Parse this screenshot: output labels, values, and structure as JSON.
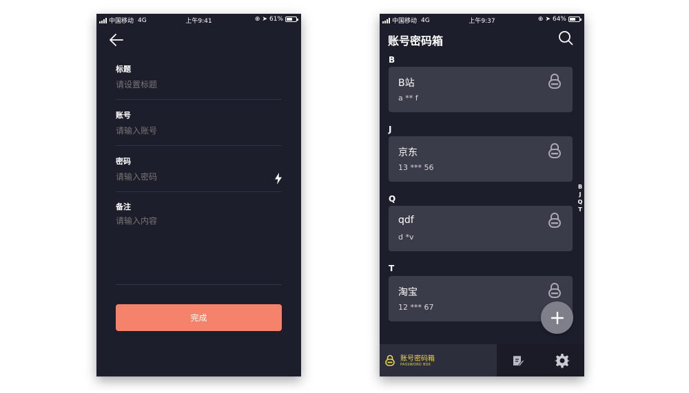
{
  "left_screen": {
    "status_bar": {
      "carrier": "中国移动",
      "network": "4G",
      "time": "上午9:41",
      "battery": "61%",
      "battery_level": 0.61
    },
    "fields": {
      "title_label": "标题",
      "title_placeholder": "请设置标题",
      "account_label": "账号",
      "account_placeholder": "请输入账号",
      "password_label": "密码",
      "password_placeholder": "请输入密码",
      "note_label": "备注",
      "note_placeholder": "请输入内容"
    },
    "done_label": "完成",
    "colors": {
      "background": "#1d1e2c",
      "accent": "#f5836c"
    }
  },
  "right_screen": {
    "status_bar": {
      "carrier": "中国移动",
      "network": "4G",
      "time": "上午9:37",
      "battery": "64%",
      "battery_level": 0.64
    },
    "title": "账号密码箱",
    "sections": [
      {
        "letter": "B",
        "name": "B站",
        "account": "a ** f"
      },
      {
        "letter": "J",
        "name": "京东",
        "account": "13 *** 56"
      },
      {
        "letter": "Q",
        "name": "qdf",
        "account": "d *v"
      },
      {
        "letter": "T",
        "name": "淘宝",
        "account": "12 *** 67"
      }
    ],
    "index_letters": [
      "B",
      "J",
      "Q",
      "T"
    ],
    "tabbar": {
      "brand_name": "账号密码箱",
      "brand_sub": "PASSWORD BOX",
      "notes_icon": "edit-icon",
      "settings_icon": "gear-icon"
    },
    "colors": {
      "card": "#3b3c4a",
      "brand_yellow": "#e8d64a"
    }
  }
}
